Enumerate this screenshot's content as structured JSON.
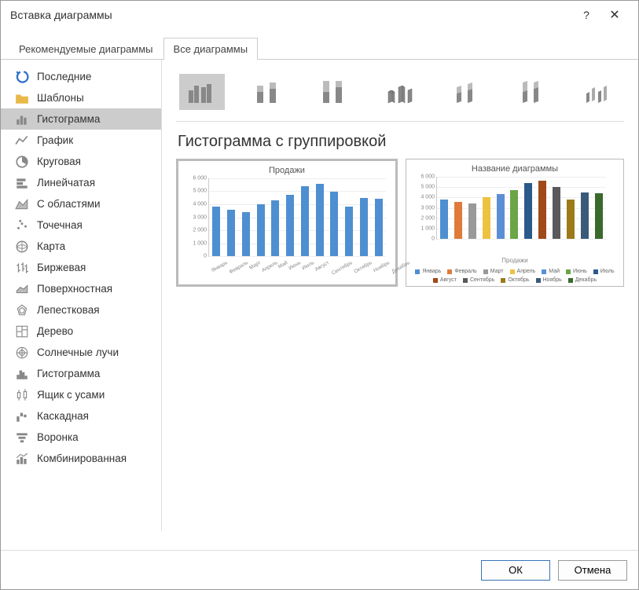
{
  "dialog_title": "Вставка диаграммы",
  "tabs": {
    "recommended": "Рекомендуемые диаграммы",
    "all": "Все диаграммы"
  },
  "sidebar": {
    "items": [
      {
        "label": "Последние"
      },
      {
        "label": "Шаблоны"
      },
      {
        "label": "Гистограмма"
      },
      {
        "label": "График"
      },
      {
        "label": "Круговая"
      },
      {
        "label": "Линейчатая"
      },
      {
        "label": "С областями"
      },
      {
        "label": "Точечная"
      },
      {
        "label": "Карта"
      },
      {
        "label": "Биржевая"
      },
      {
        "label": "Поверхностная"
      },
      {
        "label": "Лепестковая"
      },
      {
        "label": "Дерево"
      },
      {
        "label": "Солнечные лучи"
      },
      {
        "label": "Гистограмма"
      },
      {
        "label": "Ящик с усами"
      },
      {
        "label": "Каскадная"
      },
      {
        "label": "Воронка"
      },
      {
        "label": "Комбинированная"
      }
    ]
  },
  "chart_subtype_title": "Гистограмма с группировкой",
  "preview1_title": "Продажи",
  "preview2_title": "Название диаграммы",
  "preview2_xlabel": "Продажи",
  "footer": {
    "ok": "ОК",
    "cancel": "Отмена"
  },
  "chart_data": [
    {
      "type": "bar",
      "title": "Продажи",
      "categories": [
        "Январь",
        "Февраль",
        "Март",
        "Апрель",
        "Май",
        "Июнь",
        "Июль",
        "Август",
        "Сентябрь",
        "Октябрь",
        "Ноябрь",
        "Декабрь"
      ],
      "values": [
        3800,
        3600,
        3400,
        4000,
        4300,
        4700,
        5400,
        5600,
        5000,
        3800,
        4500,
        4400
      ],
      "ylim": [
        0,
        6000
      ],
      "yticks": [
        0,
        1000,
        2000,
        3000,
        4000,
        5000,
        6000
      ],
      "ytick_labels": [
        "0",
        "1 000",
        "2 000",
        "3 000",
        "4 000",
        "5 000",
        "6 000"
      ],
      "xlabel": "",
      "ylabel": ""
    },
    {
      "type": "bar",
      "title": "Название диаграммы",
      "categories": [
        "Продажи"
      ],
      "series": [
        {
          "name": "Январь",
          "values": [
            3800
          ],
          "color": "#4e8fd1"
        },
        {
          "name": "Февраль",
          "values": [
            3600
          ],
          "color": "#e07a3b"
        },
        {
          "name": "Март",
          "values": [
            3400
          ],
          "color": "#999999"
        },
        {
          "name": "Апрель",
          "values": [
            4000
          ],
          "color": "#eec241"
        },
        {
          "name": "Май",
          "values": [
            4300
          ],
          "color": "#5a8fd6"
        },
        {
          "name": "Июнь",
          "values": [
            4700
          ],
          "color": "#6ba547"
        },
        {
          "name": "Июль",
          "values": [
            5400
          ],
          "color": "#2b5a8a"
        },
        {
          "name": "Август",
          "values": [
            5600
          ],
          "color": "#a04a1a"
        },
        {
          "name": "Сентябрь",
          "values": [
            5000
          ],
          "color": "#5a5a5a"
        },
        {
          "name": "Октябрь",
          "values": [
            3800
          ],
          "color": "#9c7a1a"
        },
        {
          "name": "Ноябрь",
          "values": [
            4500
          ],
          "color": "#3a5a7a"
        },
        {
          "name": "Декабрь",
          "values": [
            4400
          ],
          "color": "#3a6a2a"
        }
      ],
      "ylim": [
        0,
        6000
      ],
      "yticks": [
        0,
        1000,
        2000,
        3000,
        4000,
        5000,
        6000
      ],
      "ytick_labels": [
        "0",
        "1 000",
        "2 000",
        "3 000",
        "4 000",
        "5 000",
        "6 000"
      ],
      "xlabel": "Продажи"
    }
  ]
}
